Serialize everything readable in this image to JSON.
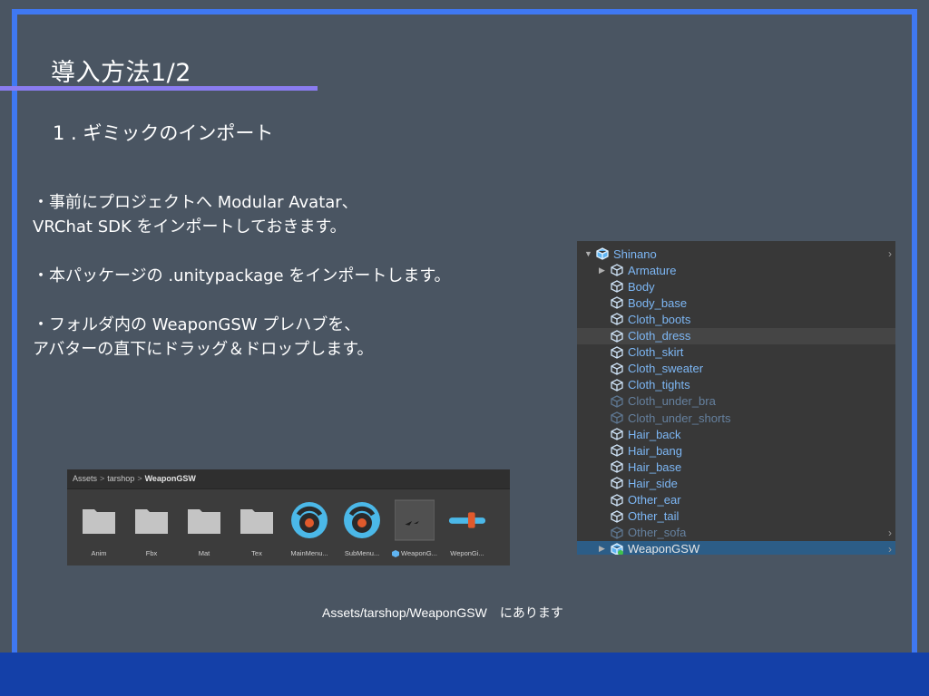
{
  "slide": {
    "title": "導入方法1/2",
    "subtitle": "1 . ギミックのインポート",
    "instructions": [
      [
        "・事前にプロジェクトへ Modular Avatar、",
        "VRChat SDK をインポートしておきます。"
      ],
      [
        "・本パッケージの .unitypackage をインポートします。"
      ],
      [
        "・フォルダ内の WeaponGSW プレハブを、",
        "アバターの直下にドラッグ＆ドロップします。"
      ]
    ],
    "caption": "Assets/tarshop/WeaponGSW　にあります"
  },
  "project_panel": {
    "breadcrumb": [
      "Assets",
      "tarshop",
      "WeaponGSW"
    ],
    "separator": ">",
    "assets": [
      {
        "label": "Anim",
        "icon": "folder-icon"
      },
      {
        "label": "Fbx",
        "icon": "folder-icon"
      },
      {
        "label": "Mat",
        "icon": "folder-icon"
      },
      {
        "label": "Tex",
        "icon": "folder-icon"
      },
      {
        "label": "MainMenu...",
        "icon": "expression-menu-icon"
      },
      {
        "label": "SubMenu...",
        "icon": "expression-menu-icon"
      },
      {
        "label": "WeaponG...",
        "icon": "prefab-thumbnail"
      },
      {
        "label": "WeponGi...",
        "icon": "parameters-icon"
      }
    ]
  },
  "hierarchy": {
    "rows": [
      {
        "label": "Shinano",
        "indent": 0,
        "state": "normal",
        "color": "blue",
        "arrow": "▼",
        "chevron": true
      },
      {
        "label": "Armature",
        "indent": 1,
        "state": "normal",
        "color": "blue",
        "arrow": "▶",
        "chevron": false
      },
      {
        "label": "Body",
        "indent": 1,
        "state": "normal",
        "color": "blue",
        "arrow": "",
        "chevron": false
      },
      {
        "label": "Body_base",
        "indent": 1,
        "state": "normal",
        "color": "blue",
        "arrow": "",
        "chevron": false
      },
      {
        "label": "Cloth_boots",
        "indent": 1,
        "state": "normal",
        "color": "blue",
        "arrow": "",
        "chevron": false
      },
      {
        "label": "Cloth_dress",
        "indent": 1,
        "state": "hover",
        "color": "blue",
        "arrow": "",
        "chevron": false
      },
      {
        "label": "Cloth_skirt",
        "indent": 1,
        "state": "normal",
        "color": "blue",
        "arrow": "",
        "chevron": false
      },
      {
        "label": "Cloth_sweater",
        "indent": 1,
        "state": "normal",
        "color": "blue",
        "arrow": "",
        "chevron": false
      },
      {
        "label": "Cloth_tights",
        "indent": 1,
        "state": "normal",
        "color": "blue",
        "arrow": "",
        "chevron": false
      },
      {
        "label": "Cloth_under_bra",
        "indent": 1,
        "state": "inactive",
        "color": "dim",
        "arrow": "",
        "chevron": false
      },
      {
        "label": "Cloth_under_shorts",
        "indent": 1,
        "state": "inactive",
        "color": "dim",
        "arrow": "",
        "chevron": false
      },
      {
        "label": "Hair_back",
        "indent": 1,
        "state": "normal",
        "color": "blue",
        "arrow": "",
        "chevron": false
      },
      {
        "label": "Hair_bang",
        "indent": 1,
        "state": "normal",
        "color": "blue",
        "arrow": "",
        "chevron": false
      },
      {
        "label": "Hair_base",
        "indent": 1,
        "state": "normal",
        "color": "blue",
        "arrow": "",
        "chevron": false
      },
      {
        "label": "Hair_side",
        "indent": 1,
        "state": "normal",
        "color": "blue",
        "arrow": "",
        "chevron": false
      },
      {
        "label": "Other_ear",
        "indent": 1,
        "state": "normal",
        "color": "blue",
        "arrow": "",
        "chevron": false
      },
      {
        "label": "Other_tail",
        "indent": 1,
        "state": "normal",
        "color": "blue",
        "arrow": "",
        "chevron": false
      },
      {
        "label": "Other_sofa",
        "indent": 1,
        "state": "inactive",
        "color": "dim",
        "arrow": "",
        "chevron": true
      },
      {
        "label": "WeaponGSW",
        "indent": 1,
        "state": "selected",
        "color": "white",
        "arrow": "▶",
        "chevron": true
      }
    ]
  },
  "colors": {
    "background": "#4a5562",
    "frame": "#3f78f2",
    "bottom_bar": "#1440a8",
    "accent_underline": "#8a7cf0",
    "unity_prefab_blue": "#7db7f5",
    "selection": "#2c5d87"
  }
}
